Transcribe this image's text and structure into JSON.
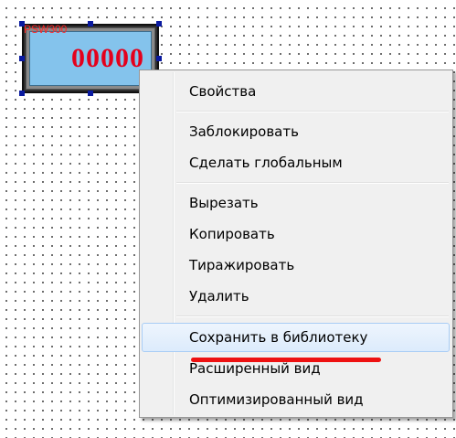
{
  "canvas_object": {
    "tag": "PSW300",
    "value": "00000",
    "colors": {
      "tag_text": "#ff2424",
      "value_text": "#e4001c",
      "screen_fill": "#84c3ec",
      "selection_handles": "#0a1aa0"
    }
  },
  "context_menu": {
    "groups": [
      {
        "items": [
          "Свойства"
        ]
      },
      {
        "items": [
          "Заблокировать",
          "Сделать глобальным"
        ]
      },
      {
        "items": [
          "Вырезать",
          "Копировать",
          "Тиражировать",
          "Удалить"
        ]
      },
      {
        "items": [
          "Сохранить в библиотеку",
          "Расширенный вид",
          "Оптимизированный вид"
        ]
      }
    ],
    "highlighted_item": "Сохранить в библиотеку",
    "annotation": {
      "type": "red-underline",
      "target": "Сохранить в библиотеку",
      "color": "#ee1111"
    }
  }
}
